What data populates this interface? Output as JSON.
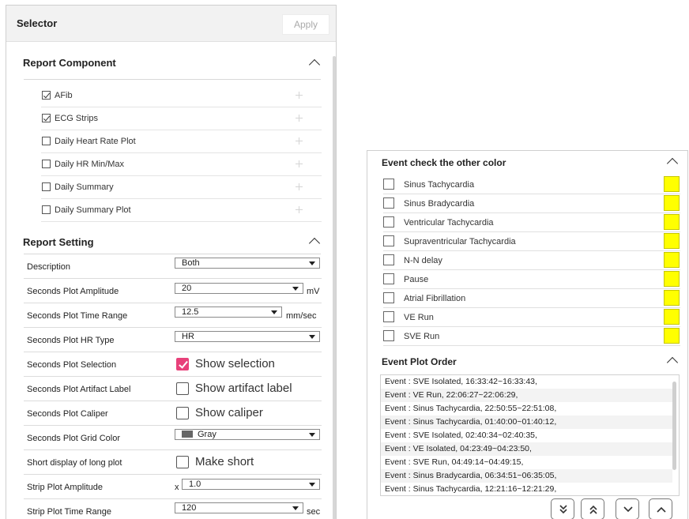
{
  "selector": {
    "title": "Selector",
    "apply_label": "Apply"
  },
  "report_component": {
    "title": "Report Component",
    "items": [
      {
        "label": "AFib",
        "checked": true
      },
      {
        "label": "ECG Strips",
        "checked": true
      },
      {
        "label": "Daily Heart Rate Plot",
        "checked": false
      },
      {
        "label": "Daily HR Min/Max",
        "checked": false
      },
      {
        "label": "Daily Summary",
        "checked": false
      },
      {
        "label": "Daily Summary Plot",
        "checked": false
      }
    ]
  },
  "report_setting": {
    "title": "Report Setting",
    "description": {
      "label": "Description",
      "value": "Both"
    },
    "amplitude": {
      "label": "Seconds Plot Amplitude",
      "value": "20",
      "unit": "mV"
    },
    "time_range": {
      "label": "Seconds Plot Time Range",
      "value": "12.5",
      "unit": "mm/sec"
    },
    "hr_type": {
      "label": "Seconds Plot HR Type",
      "value": "HR"
    },
    "selection": {
      "label": "Seconds Plot Selection",
      "option": "Show selection",
      "checked": true
    },
    "artifact": {
      "label": "Seconds Plot Artifact Label",
      "option": "Show artifact label",
      "checked": false
    },
    "caliper": {
      "label": "Seconds Plot Caliper",
      "option": "Show caliper",
      "checked": false
    },
    "grid_color": {
      "label": "Seconds Plot Grid Color",
      "value": "Gray",
      "swatch_color": "#666666"
    },
    "short_display": {
      "label": "Short display of long plot",
      "option": "Make short",
      "checked": false
    },
    "strip_amplitude": {
      "label": "Strip Plot Amplitude",
      "prefix": "x",
      "value": "1.0"
    },
    "strip_time_range": {
      "label": "Strip Plot Time Range",
      "value": "120",
      "unit": "sec"
    }
  },
  "event_color": {
    "title": "Event check the other color",
    "highlight_color": "#ffff00",
    "items": [
      {
        "label": "Sinus Tachycardia"
      },
      {
        "label": "Sinus Bradycardia"
      },
      {
        "label": "Ventricular Tachycardia"
      },
      {
        "label": "Supraventricular Tachycardia"
      },
      {
        "label": "N-N delay"
      },
      {
        "label": "Pause"
      },
      {
        "label": "Atrial Fibrillation"
      },
      {
        "label": "VE Run"
      },
      {
        "label": "SVE Run"
      }
    ]
  },
  "event_plot_order": {
    "title": "Event Plot Order",
    "items": [
      "Event : SVE Isolated, 16:33:42~16:33:43,",
      "Event : VE Run, 22:06:27~22:06:29,",
      "Event : Sinus Tachycardia, 22:50:55~22:51:08,",
      "Event : Sinus Tachycardia, 01:40:00~01:40:12,",
      "Event : SVE Isolated, 02:40:34~02:40:35,",
      "Event : VE Isolated, 04:23:49~04:23:50,",
      "Event : SVE Run, 04:49:14~04:49:15,",
      "Event : Sinus Bradycardia, 06:34:51~06:35:05,",
      "Event : Sinus Tachycardia, 12:21:16~12:21:29,"
    ],
    "buttons": [
      "move-bottom",
      "move-top",
      "move-down",
      "move-up"
    ]
  }
}
